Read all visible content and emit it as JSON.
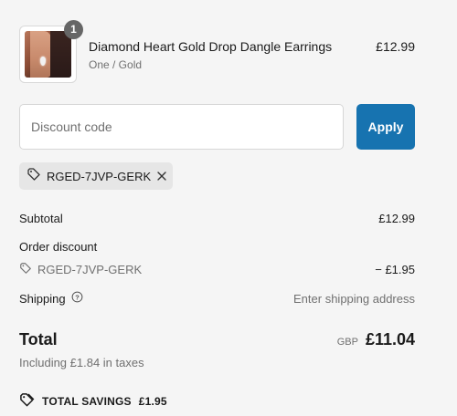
{
  "product": {
    "quantity": "1",
    "name": "Diamond Heart Gold Drop Dangle Earrings",
    "variant": "One / Gold",
    "price": "£12.99"
  },
  "discount": {
    "placeholder": "Discount code",
    "value": "",
    "apply_label": "Apply",
    "applied_code": "RGED-7JVP-GERK"
  },
  "summary": {
    "subtotal_label": "Subtotal",
    "subtotal_value": "£12.99",
    "order_discount_label": "Order discount",
    "discount_code": "RGED-7JVP-GERK",
    "discount_value": "− £1.95",
    "shipping_label": "Shipping",
    "shipping_value": "Enter shipping address",
    "total_label": "Total",
    "currency": "GBP",
    "total_value": "£11.04",
    "tax_note": "Including £1.84 in taxes",
    "savings_label": "TOTAL SAVINGS",
    "savings_value": "£1.95"
  },
  "colors": {
    "accent": "#1773b0",
    "background": "#f5f5f5",
    "muted_text": "#707070"
  },
  "icons": [
    "tag-icon",
    "close-icon",
    "info-icon",
    "savings-tag-icon"
  ]
}
